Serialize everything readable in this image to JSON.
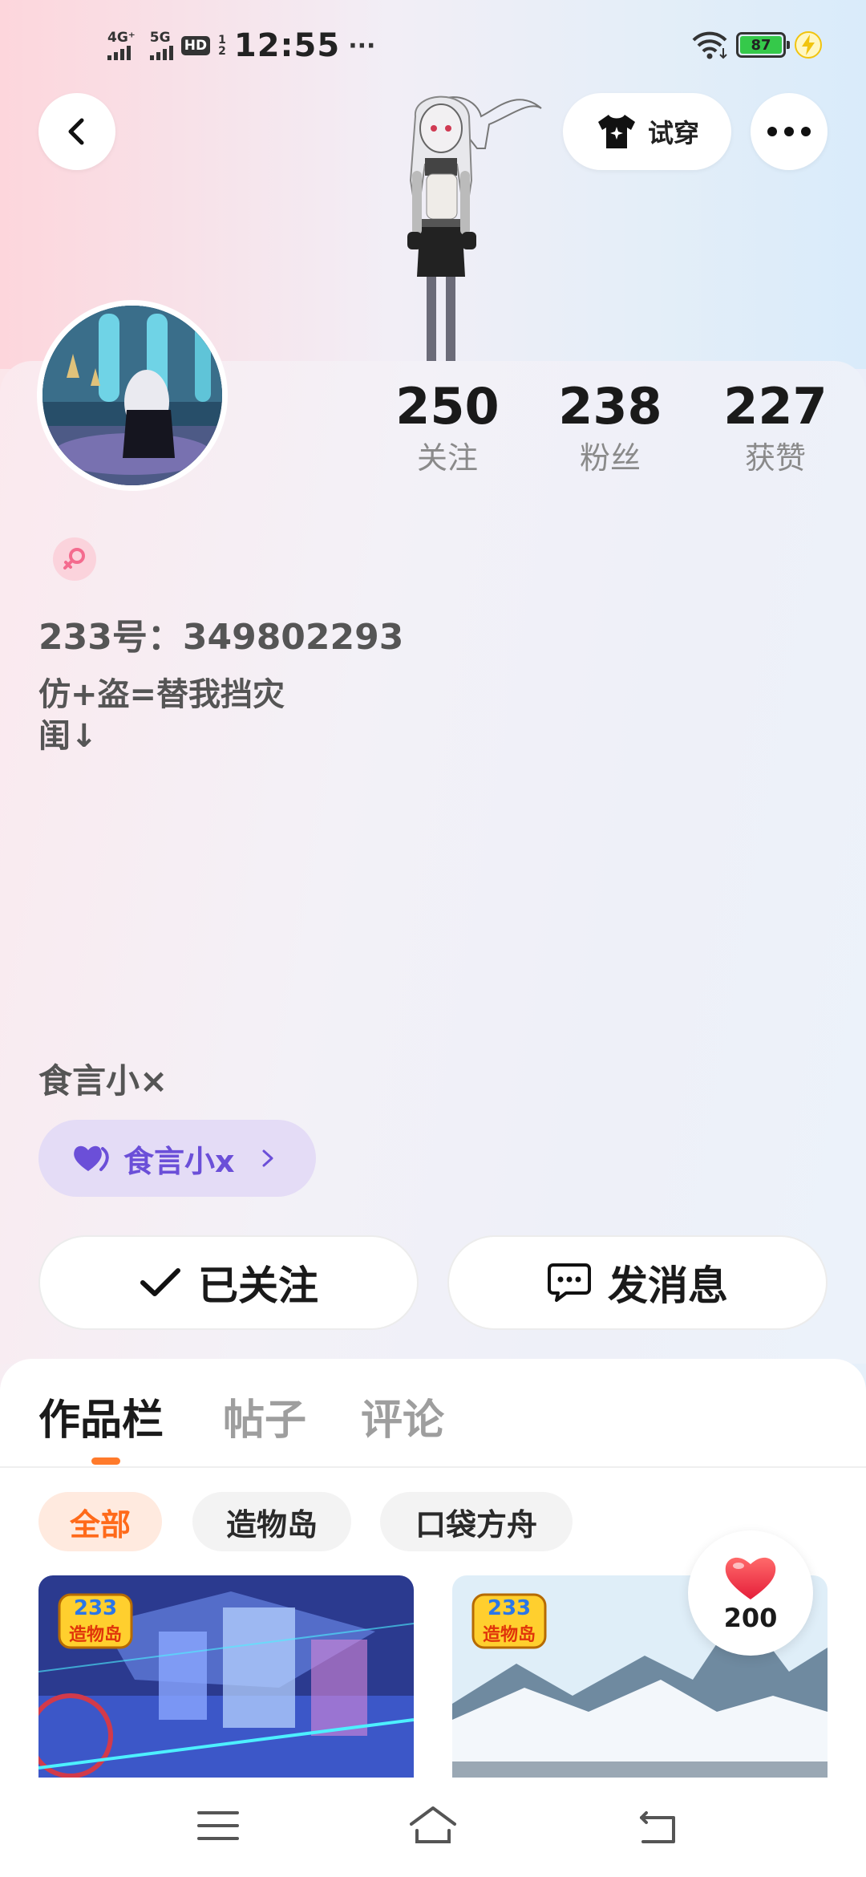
{
  "status_bar": {
    "signal_1_label": "4G⁺",
    "signal_2_label": "5G",
    "hd_label": "HD",
    "hd_sub_top": "1",
    "hd_sub_bottom": "2",
    "time": "12:55",
    "more": "···",
    "battery": "87",
    "icons": [
      "wifi-icon",
      "battery-icon",
      "charging-icon"
    ]
  },
  "top_nav": {
    "back_icon": "chevron-left-icon",
    "try_on_label": "试穿",
    "try_on_icon": "tshirt-sparkle-icon",
    "more_icon": "more-dots-icon"
  },
  "stats": [
    {
      "value": "250",
      "label": "关注"
    },
    {
      "value": "238",
      "label": "粉丝"
    },
    {
      "value": "227",
      "label": "获赞"
    }
  ],
  "profile": {
    "gender_icon": "female-icon",
    "uid": "233号：349802293",
    "bio": "仿+盗=替我挡灾\n闺↓",
    "group_name": "食言小×",
    "group_chip_label": "食言小x",
    "group_chip_icon": "heart-pair-icon"
  },
  "actions": {
    "follow_label": "已关注",
    "message_label": "发消息"
  },
  "tabs": [
    "作品栏",
    "帖子",
    "评论"
  ],
  "filters": [
    "全部",
    "造物岛",
    "口袋方舟"
  ],
  "cards": [
    {
      "badge_top": "233",
      "badge_bottom": "造物岛"
    },
    {
      "badge_top": "233",
      "badge_bottom": "造物岛"
    }
  ],
  "like_float": {
    "count": "200"
  },
  "colors": {
    "accent_orange": "#ff7a2b",
    "group_purple": "#6b4fd8",
    "like_red": "#f0323c"
  }
}
